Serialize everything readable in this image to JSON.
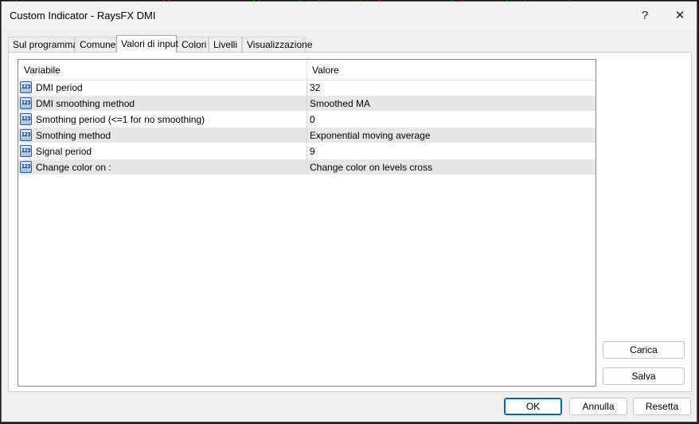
{
  "window": {
    "title": "Custom Indicator - RaysFX DMI",
    "help_label": "?",
    "close_label": "✕"
  },
  "tabs": [
    {
      "label": "Sul programma"
    },
    {
      "label": "Comune"
    },
    {
      "label": "Valori di input"
    },
    {
      "label": "Colori"
    },
    {
      "label": "Livelli"
    },
    {
      "label": "Visualizzazione"
    }
  ],
  "active_tab": "Valori di input",
  "grid": {
    "headers": {
      "variable": "Variabile",
      "value": "Valore"
    },
    "row_icon": "123-number-icon",
    "row_icon_text": "123",
    "rows": [
      {
        "name": "DMI period",
        "value": "32"
      },
      {
        "name": "DMI smoothing method",
        "value": "Smoothed MA"
      },
      {
        "name": "Smothing period (<=1 for no smoothing)",
        "value": "0"
      },
      {
        "name": "Smothing method",
        "value": "Exponential moving average"
      },
      {
        "name": "Signal period",
        "value": "9"
      },
      {
        "name": "Change color on :",
        "value": "Change color on levels cross"
      }
    ]
  },
  "side_buttons": {
    "load": "Carica",
    "save": "Salva"
  },
  "footer_buttons": {
    "ok": "OK",
    "cancel": "Annulla",
    "reset": "Resetta"
  },
  "colors": {
    "accent": "#0067c0",
    "row_alt": "#e7e7e7",
    "icon": "#2c5aa0"
  }
}
